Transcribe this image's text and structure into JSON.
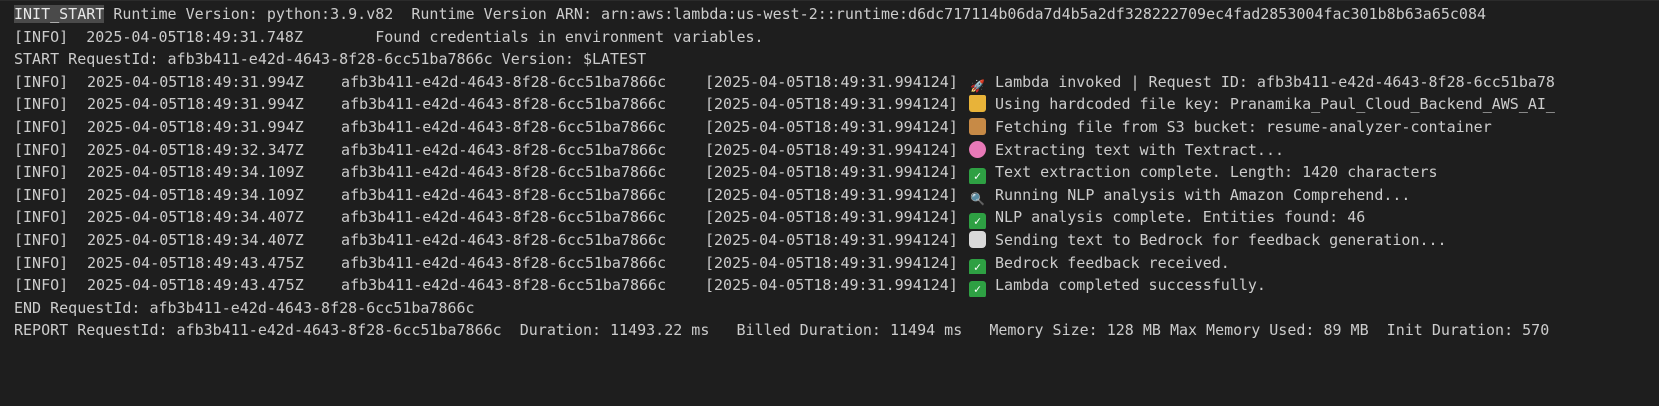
{
  "terminal": {
    "header_lines": [
      {
        "highlight": "INIT_START",
        "rest": " Runtime Version: python:3.9.v82  Runtime Version ARN: arn:aws:lambda:us-west-2::runtime:d6dc717114b06da7d4b5a2df328222709ec4fad2853004fac301b8b63a65c084"
      },
      {
        "text": "[INFO]  2025-04-05T18:49:31.748Z        Found credentials in environment variables."
      },
      {
        "text": "START RequestId: afb3b411-e42d-4643-8f28-6cc51ba7866c Version: $LATEST"
      }
    ],
    "rows": [
      {
        "level": "[INFO]",
        "time": "2025-04-05T18:49:31.994Z",
        "request_id": "afb3b411-e42d-4643-8f28-6cc51ba7866c",
        "timestamp": "[2025-04-05T18:49:31.994124]",
        "icon": "rocket-icon",
        "message": "Lambda invoked | Request ID: afb3b411-e42d-4643-8f28-6cc51ba78"
      },
      {
        "level": "[INFO]",
        "time": "2025-04-05T18:49:31.994Z",
        "request_id": "afb3b411-e42d-4643-8f28-6cc51ba7866c",
        "timestamp": "[2025-04-05T18:49:31.994124]",
        "icon": "folder-icon",
        "message": "Using hardcoded file key: Pranamika_Paul_Cloud_Backend_AWS_AI_"
      },
      {
        "level": "[INFO]",
        "time": "2025-04-05T18:49:31.994Z",
        "request_id": "afb3b411-e42d-4643-8f28-6cc51ba7866c",
        "timestamp": "[2025-04-05T18:49:31.994124]",
        "icon": "package-icon",
        "message": "Fetching file from S3 bucket: resume-analyzer-container"
      },
      {
        "level": "[INFO]",
        "time": "2025-04-05T18:49:32.347Z",
        "request_id": "afb3b411-e42d-4643-8f28-6cc51ba7866c",
        "timestamp": "[2025-04-05T18:49:31.994124]",
        "icon": "brain-icon",
        "message": "Extracting text with Textract..."
      },
      {
        "level": "[INFO]",
        "time": "2025-04-05T18:49:34.109Z",
        "request_id": "afb3b411-e42d-4643-8f28-6cc51ba7866c",
        "timestamp": "[2025-04-05T18:49:31.994124]",
        "icon": "check-icon",
        "message": "Text extraction complete. Length: 1420 characters"
      },
      {
        "level": "[INFO]",
        "time": "2025-04-05T18:49:34.109Z",
        "request_id": "afb3b411-e42d-4643-8f28-6cc51ba7866c",
        "timestamp": "[2025-04-05T18:49:31.994124]",
        "icon": "magnifier-icon",
        "message": "Running NLP analysis with Amazon Comprehend..."
      },
      {
        "level": "[INFO]",
        "time": "2025-04-05T18:49:34.407Z",
        "request_id": "afb3b411-e42d-4643-8f28-6cc51ba7866c",
        "timestamp": "[2025-04-05T18:49:31.994124]",
        "icon": "check-icon",
        "message": "NLP analysis complete. Entities found: 46"
      },
      {
        "level": "[INFO]",
        "time": "2025-04-05T18:49:34.407Z",
        "request_id": "afb3b411-e42d-4643-8f28-6cc51ba7866c",
        "timestamp": "[2025-04-05T18:49:31.994124]",
        "icon": "robot-icon",
        "message": "Sending text to Bedrock for feedback generation..."
      },
      {
        "level": "[INFO]",
        "time": "2025-04-05T18:49:43.475Z",
        "request_id": "afb3b411-e42d-4643-8f28-6cc51ba7866c",
        "timestamp": "[2025-04-05T18:49:31.994124]",
        "icon": "check-icon",
        "message": "Bedrock feedback received."
      },
      {
        "level": "[INFO]",
        "time": "2025-04-05T18:49:43.475Z",
        "request_id": "afb3b411-e42d-4643-8f28-6cc51ba7866c",
        "timestamp": "[2025-04-05T18:49:31.994124]",
        "icon": "check-icon",
        "message": "Lambda completed successfully."
      }
    ],
    "footer_lines": [
      "END RequestId: afb3b411-e42d-4643-8f28-6cc51ba7866c",
      "REPORT RequestId: afb3b411-e42d-4643-8f28-6cc51ba7866c  Duration: 11493.22 ms   Billed Duration: 11494 ms   Memory Size: 128 MB Max Memory Used: 89 MB  Init Duration: 570"
    ]
  },
  "colors": {
    "background": "#1e1e1e",
    "text": "#cccccc",
    "highlight": "#4a4a4a"
  }
}
